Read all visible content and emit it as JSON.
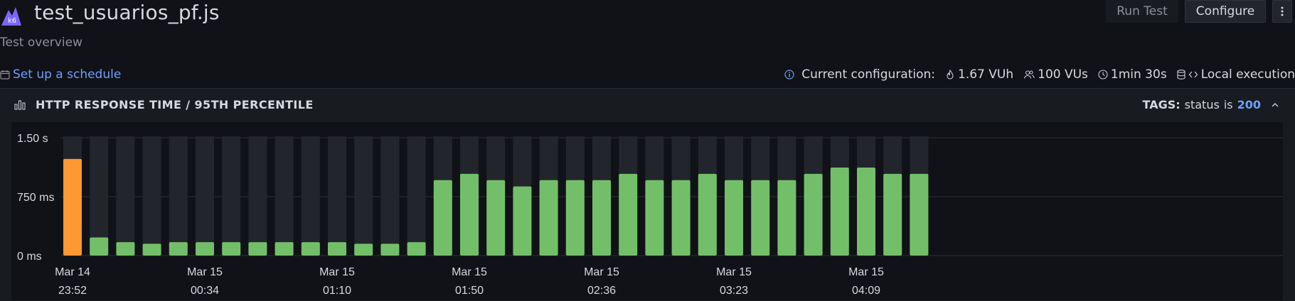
{
  "header": {
    "title": "test_usuarios_pf.js",
    "subtitle": "Test overview",
    "run_label": "Run Test",
    "configure_label": "Configure",
    "logo_text": "k6"
  },
  "schedule": {
    "label": "Set up a schedule"
  },
  "config": {
    "label": "Current configuration:",
    "vuh": "1.67 VUh",
    "vus": "100 VUs",
    "duration": "1min 30s",
    "execution": "Local execution"
  },
  "panel": {
    "title": "HTTP RESPONSE TIME / 95TH PERCENTILE",
    "tags_label": "TAGS:",
    "tag_key": "status",
    "tag_op": "is",
    "tag_value": "200"
  },
  "colors": {
    "accent": "#6e9fff",
    "highlight": "#ff9830",
    "bar": "#73bf69",
    "background_bar": "#22252b"
  },
  "chart_data": {
    "type": "bar",
    "y_ticks": [
      "1.50 s",
      "750 ms",
      "0 ms"
    ],
    "ylim": [
      0,
      1500
    ],
    "unit": "ms",
    "x_ticks": [
      {
        "index": 0,
        "date": "Mar 14",
        "time": "23:52"
      },
      {
        "index": 5,
        "date": "Mar 15",
        "time": "00:34"
      },
      {
        "index": 10,
        "date": "Mar 15",
        "time": "01:10"
      },
      {
        "index": 15,
        "date": "Mar 15",
        "time": "01:50"
      },
      {
        "index": 20,
        "date": "Mar 15",
        "time": "02:36"
      },
      {
        "index": 25,
        "date": "Mar 15",
        "time": "03:23"
      },
      {
        "index": 30,
        "date": "Mar 15",
        "time": "04:09"
      }
    ],
    "series": [
      {
        "values": [
          1230,
          230,
          170,
          150,
          170,
          170,
          170,
          170,
          170,
          170,
          170,
          150,
          150,
          170,
          960,
          1040,
          960,
          880,
          960,
          960,
          960,
          1040,
          960,
          960,
          1040,
          960,
          960,
          960,
          1040,
          1120,
          1120,
          1040,
          1040
        ],
        "highlight_index": 0
      }
    ],
    "grid": true
  }
}
